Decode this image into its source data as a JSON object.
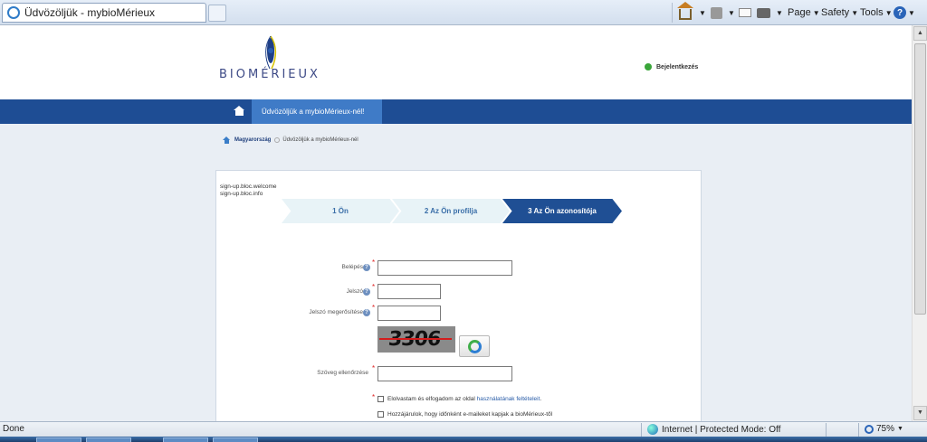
{
  "browser": {
    "tab_title": "Üdvözöljük - mybioMérieux",
    "menu": {
      "page": "Page",
      "safety": "Safety",
      "tools": "Tools"
    }
  },
  "header": {
    "logo_text": "BIOMÉRIEUX",
    "login_link": "Bejelentkezés"
  },
  "nav": {
    "active_tab": "Üdvözöljük a mybioMérieux-nél!"
  },
  "breadcrumb": {
    "country": "Magyarország",
    "current": "Üdvözöljük a mybioMérieux-nél"
  },
  "form": {
    "keys": [
      "sign-up.bloc.welcome",
      "sign-up.bloc.info"
    ],
    "steps": [
      "1 Ön",
      "2 Az Ön profilja",
      "3 Az Ön azonosítója"
    ],
    "active_step": 3,
    "login_label": "Belépés",
    "password_label": "Jelszó",
    "password_confirm_label": "Jelszó megerősítése",
    "captcha_text": "3306",
    "text_check_label": "Szöveg ellenőrzése",
    "terms_prefix": "Elolvastam és elfogadom az oldal ",
    "terms_link": "használatának feltételeit",
    "terms_suffix": ".",
    "newsletter_label": "Hozzájárulok, hogy időnként e-maileket kapjak a bioMérieux-től"
  },
  "status": {
    "left": "Done",
    "zone": "Internet | Protected Mode: Off",
    "zoom": "75%"
  }
}
